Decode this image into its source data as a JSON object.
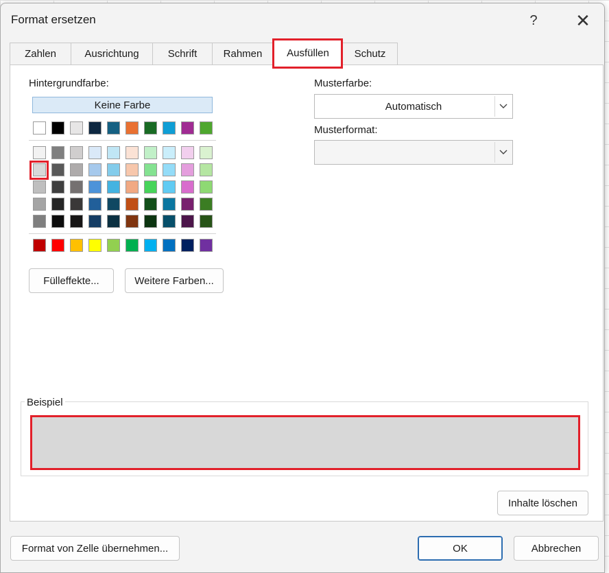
{
  "dialog": {
    "title": "Format ersetzen",
    "help_label": "?",
    "close_label": "✕"
  },
  "tabs": [
    {
      "label": "Zahlen"
    },
    {
      "label": "Ausrichtung"
    },
    {
      "label": "Schrift"
    },
    {
      "label": "Rahmen"
    },
    {
      "label": "Ausfüllen",
      "active": true
    },
    {
      "label": "Schutz"
    }
  ],
  "fill": {
    "background_label": "Hintergrundfarbe:",
    "no_color_label": "Keine Farbe",
    "fill_effects_label": "Fülleffekte...",
    "more_colors_label": "Weitere Farben...",
    "selected_swatch": {
      "row": 1,
      "col": 0,
      "color": "#d8d8d8"
    },
    "palette": {
      "theme_top": [
        "#ffffff",
        "#000000",
        "#e7e6e6",
        "#0e2841",
        "#156082",
        "#e97132",
        "#196b24",
        "#0f9ed5",
        "#a02b93",
        "#4ea72e"
      ],
      "theme_shades": [
        [
          "#f2f2f2",
          "#7f7f7f",
          "#d0cece",
          "#dae9f8",
          "#c0e6f5",
          "#fbe2d5",
          "#c1f0c8",
          "#caeefb",
          "#f2cfee",
          "#daf2d0"
        ],
        [
          "#d8d8d8",
          "#595959",
          "#aeabab",
          "#a6c9ec",
          "#83cceb",
          "#f7c7ac",
          "#84e291",
          "#94dcf8",
          "#e49edd",
          "#b5e6a2"
        ],
        [
          "#bfbfbf",
          "#3f3f3f",
          "#757171",
          "#4d93d9",
          "#44b3e1",
          "#f1a983",
          "#47d45a",
          "#61cbf3",
          "#d86dcd",
          "#8ed973"
        ],
        [
          "#a5a5a5",
          "#262626",
          "#3a3838",
          "#215f9a",
          "#104862",
          "#c04f15",
          "#124f1a",
          "#0b76a0",
          "#78206e",
          "#3b7d23"
        ],
        [
          "#7f7f7f",
          "#0d0d0d",
          "#171616",
          "#153d64",
          "#0b3041",
          "#803510",
          "#0c3511",
          "#074f6a",
          "#4c154a",
          "#275317"
        ]
      ],
      "standard": [
        "#c00000",
        "#ff0000",
        "#ffc000",
        "#ffff00",
        "#92d050",
        "#00b050",
        "#00b0f0",
        "#0070c0",
        "#002060",
        "#7030a0"
      ]
    }
  },
  "pattern": {
    "color_label": "Musterfarbe:",
    "color_value": "Automatisch",
    "style_label": "Musterformat:",
    "style_value": ""
  },
  "sample": {
    "label": "Beispiel",
    "color": "#d8d8d8"
  },
  "buttons": {
    "clear_label": "Inhalte löschen",
    "pick_from_cell_label": "Format von Zelle übernehmen...",
    "ok_label": "OK",
    "cancel_label": "Abbrechen"
  },
  "colors": {
    "highlight": "#e2202a",
    "accent": "#2b6cb0"
  }
}
